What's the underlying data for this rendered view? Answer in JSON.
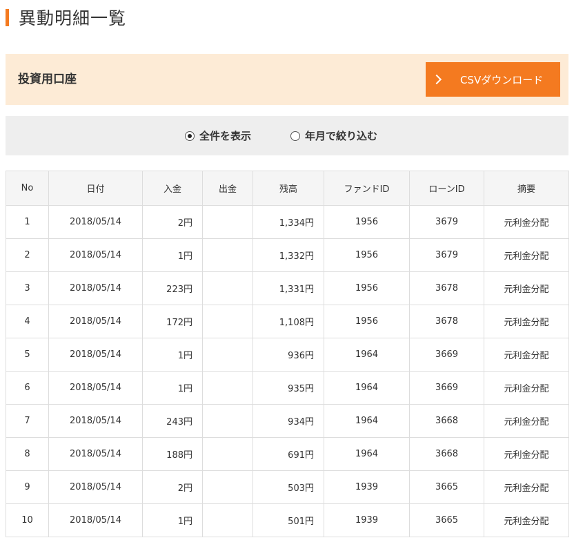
{
  "page": {
    "title": "異動明細一覧"
  },
  "account": {
    "label": "投資用口座",
    "csv_button": "CSVダウンロード"
  },
  "filter": {
    "options": [
      {
        "label": "全件を表示",
        "checked": true
      },
      {
        "label": "年月で絞り込む",
        "checked": false
      }
    ]
  },
  "table": {
    "headers": [
      "No",
      "日付",
      "入金",
      "出金",
      "残高",
      "ファンドID",
      "ローンID",
      "摘要"
    ],
    "rows": [
      [
        "1",
        "2018/05/14",
        "2円",
        "",
        "1,334円",
        "1956",
        "3679",
        "元利金分配"
      ],
      [
        "2",
        "2018/05/14",
        "1円",
        "",
        "1,332円",
        "1956",
        "3679",
        "元利金分配"
      ],
      [
        "3",
        "2018/05/14",
        "223円",
        "",
        "1,331円",
        "1956",
        "3678",
        "元利金分配"
      ],
      [
        "4",
        "2018/05/14",
        "172円",
        "",
        "1,108円",
        "1956",
        "3678",
        "元利金分配"
      ],
      [
        "5",
        "2018/05/14",
        "1円",
        "",
        "936円",
        "1964",
        "3669",
        "元利金分配"
      ],
      [
        "6",
        "2018/05/14",
        "1円",
        "",
        "935円",
        "1964",
        "3669",
        "元利金分配"
      ],
      [
        "7",
        "2018/05/14",
        "243円",
        "",
        "934円",
        "1964",
        "3668",
        "元利金分配"
      ],
      [
        "8",
        "2018/05/14",
        "188円",
        "",
        "691円",
        "1964",
        "3668",
        "元利金分配"
      ],
      [
        "9",
        "2018/05/14",
        "2円",
        "",
        "503円",
        "1939",
        "3665",
        "元利金分配"
      ],
      [
        "10",
        "2018/05/14",
        "1円",
        "",
        "501円",
        "1939",
        "3665",
        "元利金分配"
      ]
    ]
  },
  "colors": {
    "accent": "#f47a20",
    "account_bg": "#fdebd6",
    "filter_bg": "#eeeeee",
    "header_bg": "#f5f5f5"
  },
  "icons": {
    "csv_button": "chevron-right-icon"
  }
}
